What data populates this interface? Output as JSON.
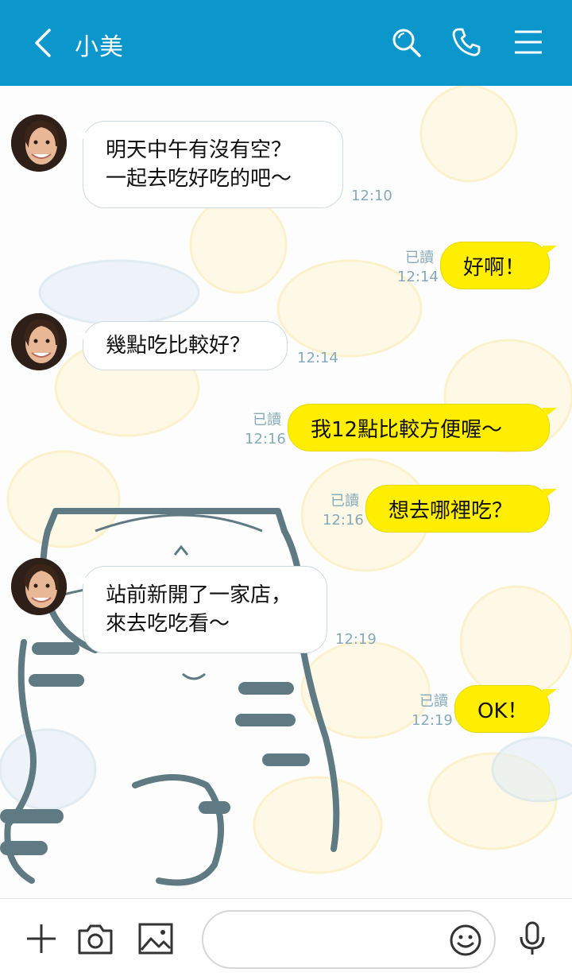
{
  "header": {
    "contact_name": "小美"
  },
  "icons": {
    "back": "chevron-left-icon",
    "search": "search-icon",
    "call": "phone-icon",
    "menu": "menu-icon",
    "add": "plus-icon",
    "camera": "camera-icon",
    "gallery": "image-icon",
    "emoji": "smiley-icon",
    "voice": "microphone-icon"
  },
  "colors": {
    "header_bg": "#0b97cc",
    "outgoing_bubble": "#ffee00",
    "incoming_bubble": "#ffffff",
    "meta_text": "#86aab9"
  },
  "messages": [
    {
      "from": "other",
      "text": "明天中午有沒有空？\n一起去吃好吃的吧～",
      "time": "12:10"
    },
    {
      "from": "me",
      "text": "好啊！",
      "status": "已讀",
      "time": "12:14"
    },
    {
      "from": "other",
      "text": "幾點吃比較好？",
      "time": "12:14"
    },
    {
      "from": "me",
      "text": "我12點比較方便喔～",
      "status": "已讀",
      "time": "12:16"
    },
    {
      "from": "me",
      "text": "想去哪裡吃？",
      "status": "已讀",
      "time": "12:16"
    },
    {
      "from": "other",
      "text": "站前新開了一家店，\n來去吃吃看～",
      "time": "12:19"
    },
    {
      "from": "me",
      "text": "OK！",
      "status": "已讀",
      "time": "12:19"
    }
  ],
  "input": {
    "placeholder": "",
    "value": ""
  }
}
